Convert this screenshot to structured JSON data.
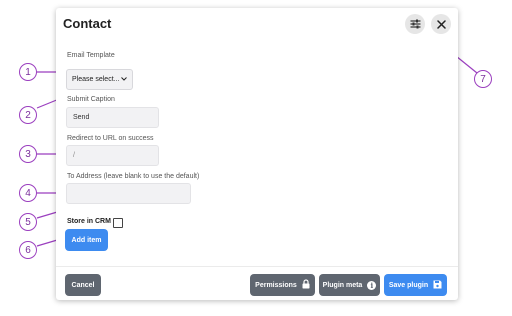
{
  "dialog": {
    "title": "Contact",
    "settings_icon": "sliders-icon",
    "close_icon": "close-icon"
  },
  "form": {
    "email_template": {
      "label": "Email Template",
      "value": "Please select...",
      "dropdown_icon": "chevron-down-icon"
    },
    "submit_caption": {
      "label": "Submit Caption",
      "value": "Send"
    },
    "redirect_url": {
      "label": "Redirect to URL on success",
      "placeholder": "/"
    },
    "to_address": {
      "label": "To Address (leave blank to use the default)",
      "value": ""
    },
    "store_in_crm": {
      "label": "Store in CRM",
      "checked": false
    },
    "add_item_label": "Add item"
  },
  "footer": {
    "cancel_label": "Cancel",
    "permissions_label": "Permissions",
    "permissions_icon": "lock-icon",
    "plugin_meta_label": "Plugin meta",
    "plugin_meta_icon": "info-icon",
    "plugin_meta_icon_glyph": "i",
    "save_label": "Save plugin",
    "save_icon": "floppy-disk-icon"
  },
  "callouts": [
    "1",
    "2",
    "3",
    "4",
    "5",
    "6",
    "7"
  ],
  "colors": {
    "accent_blue": "#3d8bf0",
    "button_gray": "#5f6670",
    "callout_purple": "#9b3fbf"
  }
}
